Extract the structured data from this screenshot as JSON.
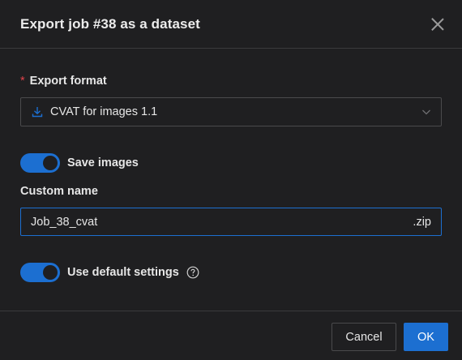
{
  "dialog": {
    "title": "Export job #38 as a dataset"
  },
  "export_format": {
    "required_mark": "*",
    "label": "Export format",
    "selected_value": "CVAT for images 1.1",
    "icon": "download-icon"
  },
  "save_images": {
    "label": "Save images",
    "enabled": true
  },
  "custom_name": {
    "label": "Custom name",
    "value": "Job_38_cvat",
    "suffix": ".zip"
  },
  "default_settings": {
    "label": "Use default settings",
    "enabled": true,
    "icon": "question-circle-icon"
  },
  "footer": {
    "cancel_label": "Cancel",
    "ok_label": "OK"
  },
  "colors": {
    "accent": "#1c6fd1",
    "background": "#1f1f21",
    "required": "#e0434b"
  }
}
